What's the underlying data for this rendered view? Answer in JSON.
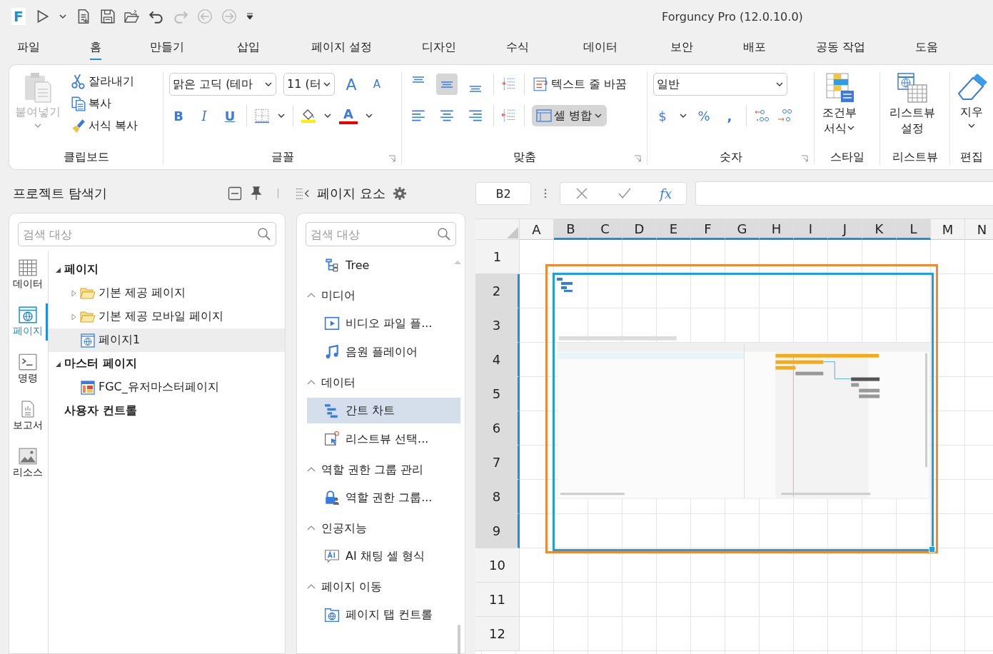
{
  "title_bar": {
    "logo": "F",
    "title": "Forguncy Pro (12.0.10.0)"
  },
  "menu_tabs": [
    {
      "label": "파일",
      "selected": false
    },
    {
      "label": "홈",
      "selected": true
    },
    {
      "label": "만들기",
      "selected": false
    },
    {
      "label": "삽입",
      "selected": false
    },
    {
      "label": "페이지 설정",
      "selected": false
    },
    {
      "label": "디자인",
      "selected": false
    },
    {
      "label": "수식",
      "selected": false
    },
    {
      "label": "데이터",
      "selected": false
    },
    {
      "label": "보안",
      "selected": false
    },
    {
      "label": "배포",
      "selected": false
    },
    {
      "label": "공동 작업",
      "selected": false
    },
    {
      "label": "도움",
      "selected": false
    }
  ],
  "ribbon": {
    "clipboard": {
      "label": "클립보드",
      "paste": {
        "label": "붙여넣기",
        "disabled": true
      },
      "cut": "잘라내기",
      "copy": "복사",
      "format_painter": "서식 복사"
    },
    "font": {
      "label": "글꼴",
      "font_name": "맑은 고딕 (테마",
      "font_size": "11 (터",
      "grow": "A",
      "shrink": "A",
      "bold": "B",
      "italic": "I",
      "underline": "U",
      "font_color": "A"
    },
    "alignment": {
      "label": "맞춤",
      "vertical": [
        {
          "kind": "top",
          "selected": false
        },
        {
          "kind": "middle",
          "selected": true
        },
        {
          "kind": "bottom",
          "selected": false
        }
      ],
      "horizontal": [
        {
          "kind": "left",
          "selected": false
        },
        {
          "kind": "center",
          "selected": false
        },
        {
          "kind": "right",
          "selected": false
        }
      ],
      "wrap_text": "텍스트 줄 바꿈",
      "merge_cells": {
        "label": "셀 병합",
        "selected": true
      }
    },
    "number": {
      "label": "숫자",
      "format": "일반",
      "currency": "$",
      "percent": "%",
      "comma": ","
    },
    "style": {
      "label": "스타일",
      "conditional_format": "조건부 서식"
    },
    "listview": {
      "label": "리스트뷰",
      "settings": "리스트뷰 설정"
    },
    "editing": {
      "label": "편집",
      "clear": "지우"
    }
  },
  "explorer": {
    "title": "프로젝트 탐색기",
    "search_placeholder": "검색 대상",
    "nav": [
      {
        "kind": "data",
        "label": "데이터",
        "selected": false
      },
      {
        "kind": "page",
        "label": "페이지",
        "selected": true
      },
      {
        "kind": "command",
        "label": "명령",
        "selected": false
      },
      {
        "kind": "report",
        "label": "보고서",
        "selected": false
      },
      {
        "kind": "resource",
        "label": "리소스",
        "selected": false
      }
    ],
    "tree": [
      {
        "label": "페이지",
        "expanded": true,
        "selected": false,
        "children": [
          {
            "kind": "folder",
            "label": "기본 제공 페이지",
            "expanded": false,
            "selected": false
          },
          {
            "kind": "folder",
            "label": "기본 제공 모바일 페이지",
            "expanded": false,
            "selected": false
          },
          {
            "kind": "page",
            "label": "페이지1",
            "selected": true
          }
        ]
      },
      {
        "label": "마스터 페이지",
        "expanded": true,
        "selected": false,
        "children": [
          {
            "kind": "master",
            "label": "FGC_유저마스터페이지",
            "selected": false
          }
        ]
      },
      {
        "label": "사용자 컨트롤",
        "selected": false
      }
    ]
  },
  "elements": {
    "title": "페이지 요소",
    "search_placeholder": "검색 대상",
    "items": [
      {
        "kind": "tree",
        "label": "Tree",
        "selected": false
      }
    ],
    "groups": [
      {
        "label": "미디어",
        "expanded": true,
        "items": [
          {
            "kind": "video",
            "label": "비디오 파일 플...",
            "selected": false
          },
          {
            "kind": "audio",
            "label": "음원 플레이어",
            "selected": false
          }
        ]
      },
      {
        "label": "데이터",
        "expanded": true,
        "items": [
          {
            "kind": "gantt",
            "label": "간트 차트",
            "selected": true
          },
          {
            "kind": "listview",
            "label": "리스트뷰 선택...",
            "selected": false
          }
        ]
      },
      {
        "label": "역할 권한 그룹 관리",
        "expanded": true,
        "items": [
          {
            "kind": "role",
            "label": "역할 권한 그룹...",
            "selected": false
          }
        ]
      },
      {
        "label": "인공지능",
        "expanded": true,
        "items": [
          {
            "kind": "ai",
            "label": "AI 채팅 셀 형식",
            "selected": false
          }
        ]
      },
      {
        "label": "페이지 이동",
        "expanded": true,
        "items": [
          {
            "kind": "tab",
            "label": "페이지 탭 컨트롤",
            "selected": false
          }
        ]
      }
    ]
  },
  "sheet": {
    "name_box": "B2",
    "function_label": "fx",
    "columns": [
      {
        "label": "A",
        "selected": false
      },
      {
        "label": "B",
        "selected": true
      },
      {
        "label": "C",
        "selected": true
      },
      {
        "label": "D",
        "selected": true
      },
      {
        "label": "E",
        "selected": true
      },
      {
        "label": "F",
        "selected": true
      },
      {
        "label": "G",
        "selected": true
      },
      {
        "label": "H",
        "selected": true
      },
      {
        "label": "I",
        "selected": true
      },
      {
        "label": "J",
        "selected": true
      },
      {
        "label": "K",
        "selected": true
      },
      {
        "label": "L",
        "selected": true
      },
      {
        "label": "M",
        "selected": false
      },
      {
        "label": "N",
        "selected": false
      }
    ],
    "rows": [
      {
        "label": "1",
        "selected": false
      },
      {
        "label": "2",
        "selected": true
      },
      {
        "label": "3",
        "selected": true
      },
      {
        "label": "4",
        "selected": true
      },
      {
        "label": "5",
        "selected": true
      },
      {
        "label": "6",
        "selected": true
      },
      {
        "label": "7",
        "selected": true
      },
      {
        "label": "8",
        "selected": true
      },
      {
        "label": "9",
        "selected": true
      },
      {
        "label": "10",
        "selected": false
      },
      {
        "label": "11",
        "selected": false
      },
      {
        "label": "12",
        "selected": false
      }
    ]
  }
}
